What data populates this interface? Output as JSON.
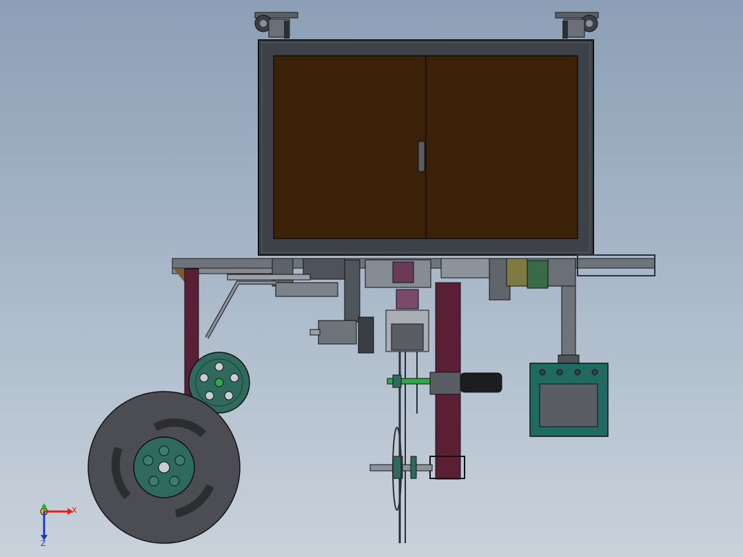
{
  "viewport": {
    "title": "",
    "background_gradient": [
      "#8c9fb6",
      "#c9d2db"
    ]
  },
  "triad": {
    "x_label": "X",
    "y_label": "Y",
    "z_label": "Z",
    "x_color": "#e0201c",
    "y_color": "#22b02a",
    "z_color": "#1c38c8"
  },
  "model": {
    "cabinet_frame_color": "#3d4148",
    "cabinet_door_color": "#3a2108",
    "frame_color": "#6e747c",
    "post_color": "#5a1e35",
    "wheel_hub_color": "#2f6b5c",
    "tire_color": "#4b4d52",
    "panel_color": "#1f6b62",
    "shaft_color": "#2fa84a"
  }
}
